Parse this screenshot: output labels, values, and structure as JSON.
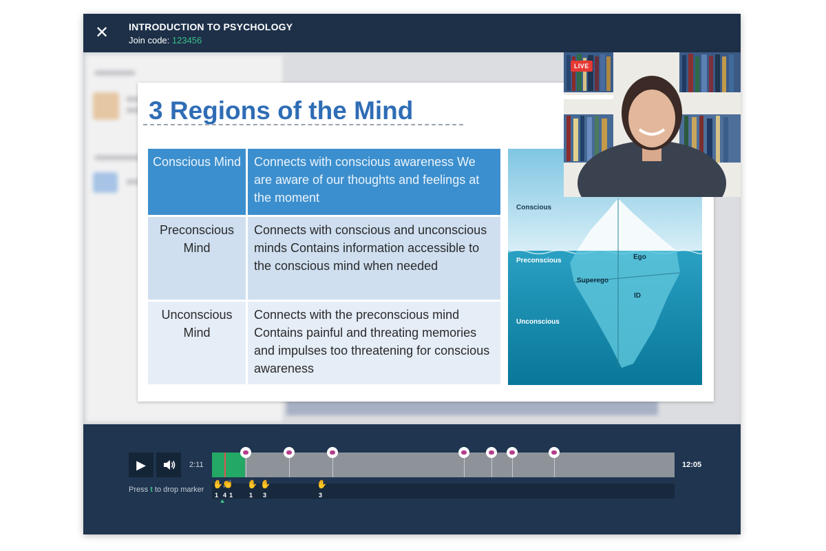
{
  "header": {
    "close_icon": "✕",
    "course_title": "INTRODUCTION TO PSYCHOLOGY",
    "join_label": "Join code:",
    "join_code": "123456"
  },
  "webcam": {
    "live_label": "LIVE"
  },
  "slide": {
    "title": "3 Regions of the Mind",
    "rows": [
      {
        "region": "Conscious Mind",
        "description": "Connects with conscious awareness We are aware of our thoughts and feelings at the moment"
      },
      {
        "region": "Preconscious Mind",
        "description": "Connects with conscious and unconscious minds Contains information accessible to the conscious mind when needed"
      },
      {
        "region": "Unconscious Mind",
        "description": "Connects with the preconscious mind Contains painful and threating memories and impulses too threatening for conscious awareness"
      }
    ],
    "iceberg_labels": {
      "conscious": "Conscious",
      "preconscious": "Preconscious",
      "unconscious": "Unconscious",
      "ego": "Ego",
      "superego": "Superego",
      "id": "ID"
    }
  },
  "player": {
    "current_time": "2:11",
    "total_time": "12:05",
    "hint_prefix": "Press",
    "hint_key": "t",
    "hint_suffix": "to drop marker",
    "reaction_counts": [
      "1",
      "4",
      "1",
      "1",
      "3",
      "3"
    ]
  },
  "colors": {
    "header_bg": "#1d3048",
    "accent_green": "#3cc08a",
    "slide_title_blue": "#2f6db5",
    "live_red": "#e53935"
  }
}
